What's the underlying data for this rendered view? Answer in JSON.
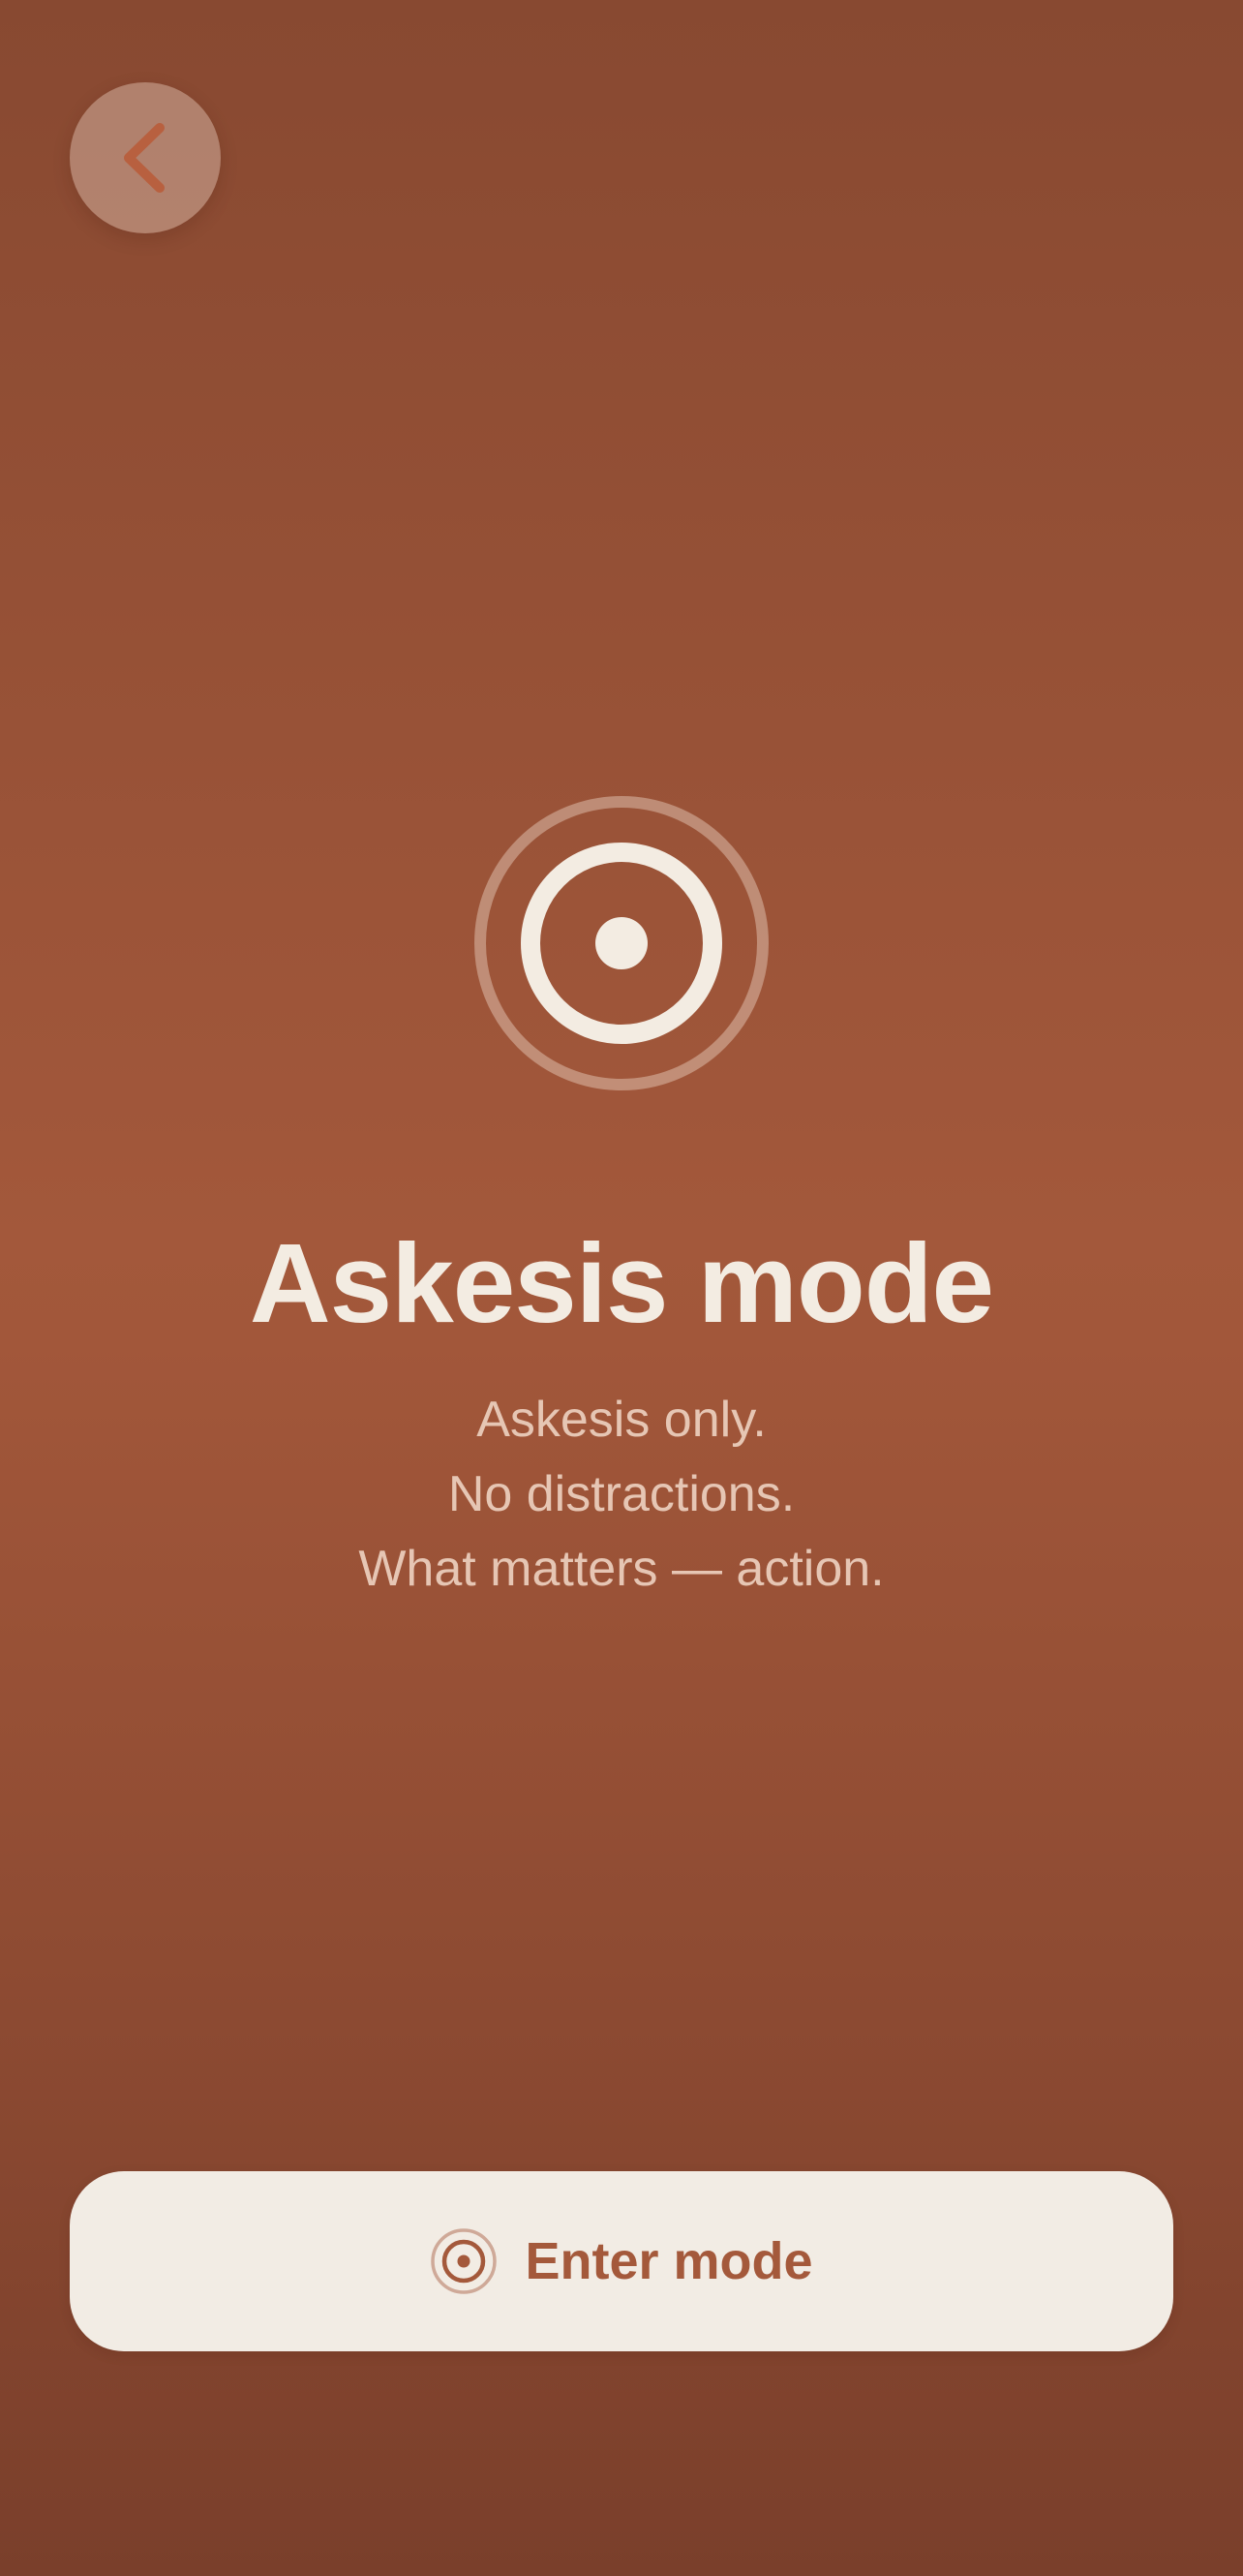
{
  "header": {
    "back_icon": "chevron-left-icon"
  },
  "hero": {
    "icon": "target-icon",
    "title": "Askesis mode",
    "subtitle_lines": [
      "Askesis only.",
      "No distractions.",
      "What matters — action."
    ]
  },
  "footer": {
    "enter_label": "Enter mode",
    "enter_icon": "target-icon"
  },
  "colors": {
    "background_top": "#884931",
    "background_middle": "#a3583b",
    "background_bottom": "#7a3f2b",
    "title": "#f3ece2",
    "subtitle": "#e6c6b4",
    "button_background": "#f2ece4",
    "accent": "#a4593b"
  }
}
